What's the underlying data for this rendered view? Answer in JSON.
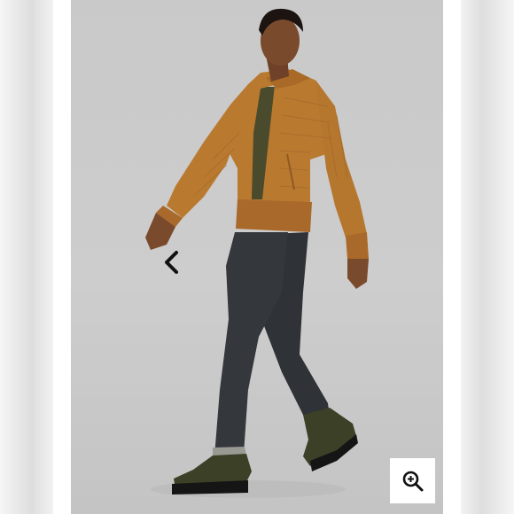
{
  "gallery": {
    "prev_icon": "chevron-left-icon",
    "next_icon": "chevron-right-icon",
    "zoom_icon": "zoom-in-icon",
    "background_color": "#cbcbcb",
    "jacket_color": "#b97a30"
  }
}
